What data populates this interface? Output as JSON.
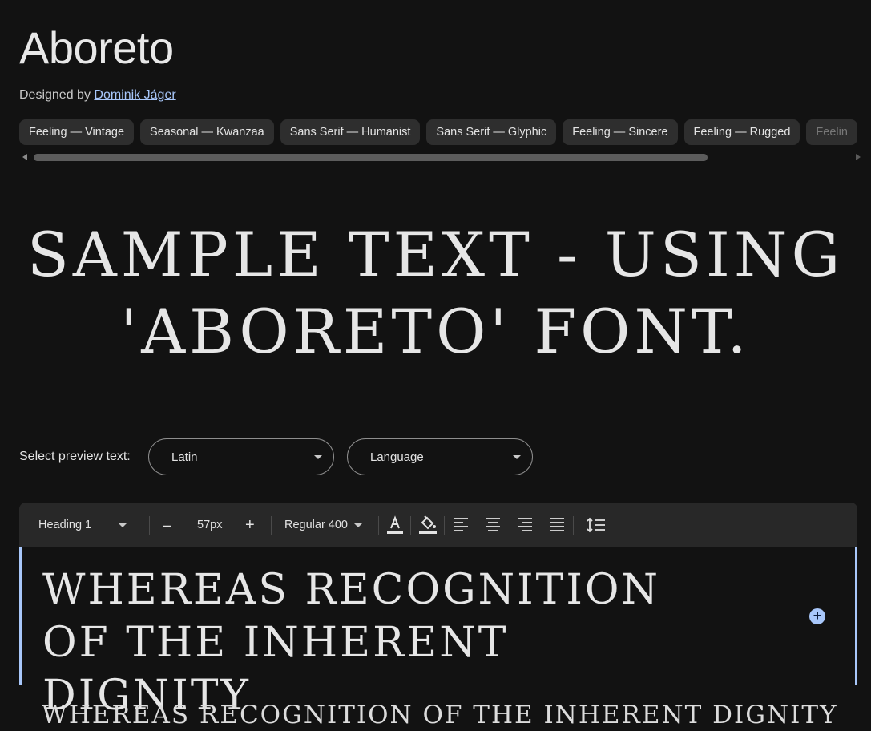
{
  "font": {
    "name": "Aboreto",
    "designed_by_label": "Designed by",
    "designer": "Dominik Jáger"
  },
  "tags": [
    "Feeling — Vintage",
    "Seasonal — Kwanzaa",
    "Sans Serif — Humanist",
    "Sans Serif — Glyphic",
    "Feeling — Sincere",
    "Feeling — Rugged",
    "Feelin"
  ],
  "sample_text": {
    "line1": "SAMPLE TEXT - USING",
    "line2": "'ABORETO' FONT."
  },
  "preview": {
    "label": "Select preview text:",
    "script_value": "Latin",
    "language_value": "Language"
  },
  "toolbar": {
    "style": "Heading 1",
    "decrease": "–",
    "size": "57px",
    "increase": "+",
    "weight": "Regular 400"
  },
  "editor": {
    "text": "WHEREAS RECOGNITION OF THE INHERENT DIGNITY",
    "next_line": "WHEREAS RECOGNITION OF THE INHERENT DIGNITY"
  },
  "colors": {
    "background": "#121212",
    "accent": "#a8c7fa",
    "chip": "#2e2e2e",
    "toolbar": "#282828"
  }
}
